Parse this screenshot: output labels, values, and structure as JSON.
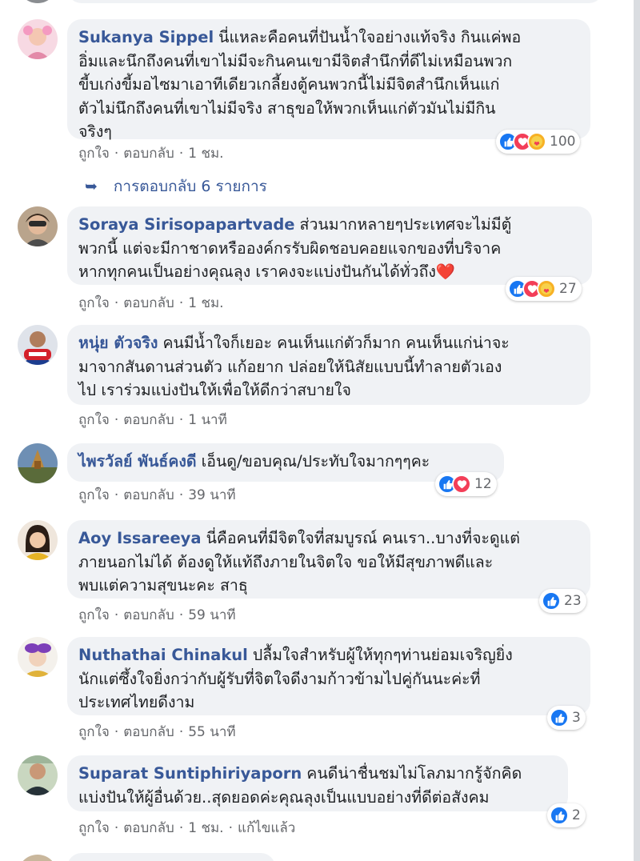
{
  "comments": [
    {
      "author": "Sukanya Sippel",
      "lines": [
        "นี่แหละคือคนที่ปันน้ำใจอย่างแท้จริง กินแค่พอ",
        "อิ่มและนึกถึงคนที่เขาไม่มีจะกินคนเขามีจิตสำนึกที่ดีไม่เหมือนพวก",
        "ขี้บเก่งขี้มอไซมาเอาทีเดียวเกลี้ยงตู้คนพวกนี้ไม่มีจิตสำนึกเห็นแก่",
        "ตัวไม่นึกถึงคนที่เขาไม่มีจริง สาธุขอให้พวกเห็นแก่ตัวมันไม่มีกิน",
        "จริงๆ"
      ],
      "like_label": "ถูกใจ",
      "reply_label": "ตอบกลับ",
      "time": "1 ชม.",
      "reaction_count": "100"
    },
    {
      "author": "Soraya Sirisopapartvade",
      "lines": [
        "ส่วนมากหลายๆประเทศจะไม่มีตู้",
        "พวกนี้ แต่จะมีกาชาดหรือองค์กรรับผิดชอบคอยแจกของที่บริจาค",
        "หากทุกคนเป็นอย่างคุณลุง เราคงจะแบ่งปันกันได้ทั่วถึง❤️"
      ],
      "like_label": "ถูกใจ",
      "reply_label": "ตอบกลับ",
      "time": "1 ชม.",
      "reaction_count": "27"
    },
    {
      "author": "หนุ่ย ตัวจริง",
      "lines": [
        "คนมีน้ำใจก็เยอะ คนเห็นแก่ตัวก็มาก คนเห็นแก่น่าจะ",
        "มาจากสันดานส่วนตัว แก้อยาก ปล่อยให้นิสัยแบบนี้ทำลายตัวเอง",
        "ไป เราร่วมแบ่งปันให้เพื่อให้ดีกว่าสบายใจ"
      ],
      "like_label": "ถูกใจ",
      "reply_label": "ตอบกลับ",
      "time": "1 นาที",
      "reaction_count": ""
    },
    {
      "author": "ไพรวัลย์ พันธ์คงดี",
      "lines": [
        "เอ็นดู/ขอบคุณ/ประทับใจมากๆๆคะ"
      ],
      "like_label": "ถูกใจ",
      "reply_label": "ตอบกลับ",
      "time": "39 นาที",
      "reaction_count": "12"
    },
    {
      "author": "Aoy Issareeya",
      "lines": [
        "นี่คือคนที่มีจิตใจที่สมบูรณ์ คนเรา..บางที่จะดูแต่",
        "ภายนอกไม่ได้ ต้องดูให้แท้ถึงภายในจิตใจ ขอให้มีสุขภาพดีและ",
        "พบแต่ความสุขนะคะ สาธุ"
      ],
      "like_label": "ถูกใจ",
      "reply_label": "ตอบกลับ",
      "time": "59 นาที",
      "reaction_count": "23"
    },
    {
      "author": "Nuthathai Chinakul",
      "lines": [
        "ปลื้มใจสำหรับผู้ให้ทุกๆท่านย่อมเจริญยิ่ง",
        "นักแต่ซึ้งใจยิ่งกว่ากับผู้รับที่จิตใจดีงามก้าวข้ามไปคู่กันนะค่ะที่",
        "ประเทศไทยดีงาม"
      ],
      "like_label": "ถูกใจ",
      "reply_label": "ตอบกลับ",
      "time": "55 นาที",
      "reaction_count": "3"
    },
    {
      "author": "Suparat Suntiphiriyaporn",
      "lines": [
        "คนดีน่าชื่นชมไม่โลภมากรู้จักคิด",
        "แบ่งปันให้ผู้อื่นด้วย..สุดยอดค่ะคุณลุงเป็นแบบอย่างที่ดีต่อสังคม"
      ],
      "like_label": "ถูกใจ",
      "reply_label": "ตอบกลับ",
      "time": "1 ชม.",
      "edited_label": "แก้ไขแล้ว",
      "reaction_count": "2"
    }
  ],
  "replies_link": "การตอบกลับ 6 รายการ",
  "icons": {
    "like": "like-icon",
    "love": "love-icon",
    "care": "care-icon",
    "reply_arrow": "reply-arrow-icon"
  },
  "colors": {
    "author": "#385898",
    "bubble": "#f0f2f5",
    "meta": "#65676b",
    "like": "#1877f2",
    "love": "#f33e58",
    "care": "#f7b125"
  }
}
